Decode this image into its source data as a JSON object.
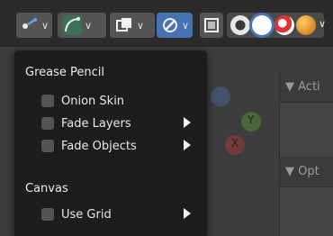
{
  "popup": {
    "sections": [
      {
        "title": "Grease Pencil",
        "items": [
          {
            "label": "Onion Skin",
            "checked": false,
            "has_submenu": false
          },
          {
            "label": "Fade Layers",
            "checked": false,
            "has_submenu": true
          },
          {
            "label": "Fade Objects",
            "checked": false,
            "has_submenu": true
          }
        ]
      },
      {
        "title": "Canvas",
        "items": [
          {
            "label": "Use Grid",
            "checked": false,
            "has_submenu": true
          }
        ]
      }
    ]
  },
  "viewport": {
    "gizmo_labels": {
      "y": "Y",
      "x": "X"
    },
    "side_panel_headers": [
      "Acti",
      "Opt"
    ]
  },
  "colors": {
    "accent": "#4772b3",
    "menu_bg": "#1d1d1d",
    "checkbox": "#545454",
    "header_bg": "#2b2b2b"
  },
  "icons": [
    "pivot-icon",
    "snap-curve-icon",
    "overlay-icon",
    "gp-overlay-icon",
    "xray-icon",
    "wireframe-shading-icon",
    "solid-shading-icon",
    "material-shading-icon",
    "rendered-shading-icon"
  ]
}
